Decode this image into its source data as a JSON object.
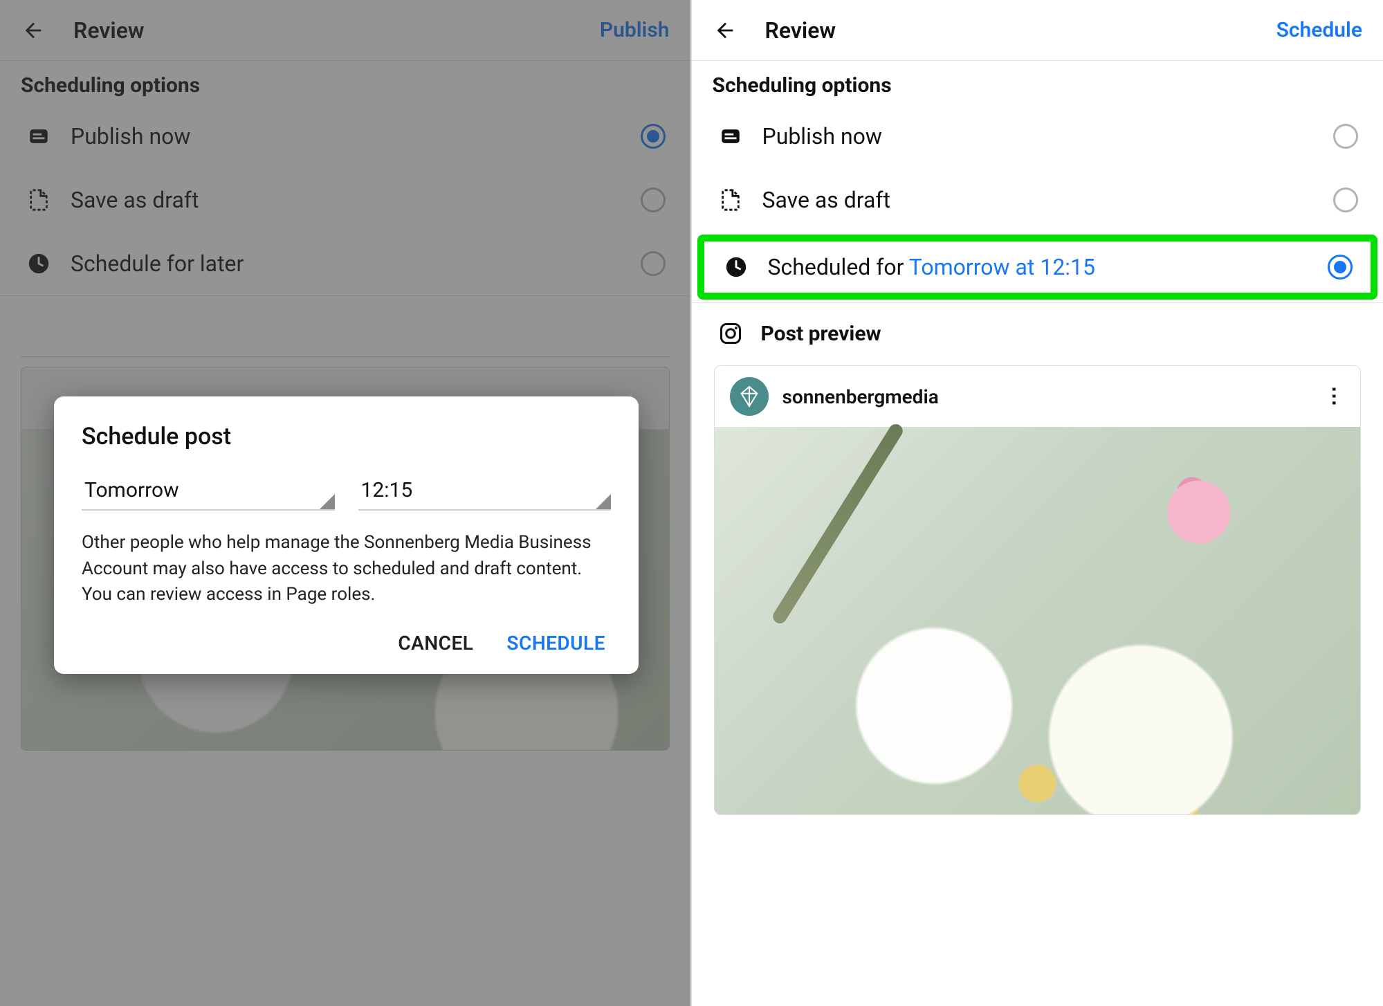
{
  "left": {
    "header": {
      "title": "Review",
      "action": "Publish"
    },
    "section_title": "Scheduling options",
    "options": {
      "publish_now": "Publish now",
      "save_draft": "Save as draft",
      "schedule_later": "Schedule for later"
    },
    "modal": {
      "title": "Schedule post",
      "date_value": "Tomorrow",
      "time_value": "12:15",
      "body": "Other people who help manage the Sonnenberg Media Business Account may also have access to scheduled and draft content. You can review access in Page roles.",
      "cancel": "CANCEL",
      "confirm": "SCHEDULE"
    }
  },
  "right": {
    "header": {
      "title": "Review",
      "action": "Schedule"
    },
    "section_title": "Scheduling options",
    "options": {
      "publish_now": "Publish now",
      "save_draft": "Save as draft",
      "scheduled_prefix": "Scheduled for ",
      "scheduled_time": "Tomorrow at 12:15"
    },
    "preview": {
      "label": "Post preview",
      "username": "sonnenbergmedia"
    }
  }
}
